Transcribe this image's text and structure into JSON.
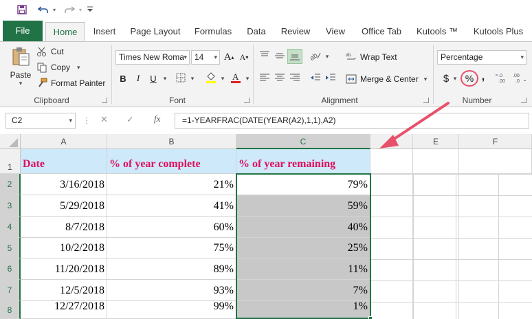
{
  "qat": {
    "save_icon": "save-icon",
    "undo_icon": "undo-icon",
    "redo_icon": "redo-icon",
    "customize_icon": "customize-qat-icon"
  },
  "tabs": [
    {
      "label": "File"
    },
    {
      "label": "Home"
    },
    {
      "label": "Insert"
    },
    {
      "label": "Page Layout"
    },
    {
      "label": "Formulas"
    },
    {
      "label": "Data"
    },
    {
      "label": "Review"
    },
    {
      "label": "View"
    },
    {
      "label": "Office Tab"
    },
    {
      "label": "Kutools ™"
    },
    {
      "label": "Kutools Plus"
    }
  ],
  "clipboard": {
    "paste": "Paste",
    "cut": "Cut",
    "copy": "Copy",
    "format_painter": "Format Painter",
    "label": "Clipboard"
  },
  "font": {
    "name": "Times New Roma",
    "size": "14",
    "bold": "B",
    "italic": "I",
    "underline": "U",
    "label": "Font",
    "grow": "A",
    "shrink": "A"
  },
  "alignment": {
    "wrap_text": "Wrap Text",
    "merge_center": "Merge & Center",
    "label": "Alignment"
  },
  "number": {
    "format": "Percentage",
    "currency": "$",
    "percent": "%",
    "comma": ",",
    "inc_decimal": "←.0 .00",
    "dec_decimal": ".00 →.0",
    "label": "Number"
  },
  "formula_bar": {
    "name_box": "C2",
    "fx": "fx",
    "formula": "=1-YEARFRAC(DATE(YEAR(A2),1,1),A2)"
  },
  "columns": [
    "A",
    "B",
    "C",
    "E",
    "F"
  ],
  "row_numbers": [
    "1",
    "2",
    "3",
    "4",
    "5",
    "6",
    "7",
    "8"
  ],
  "headers": {
    "a": "Date",
    "b": "% of year complete",
    "c": "% of year remaining"
  },
  "rows": [
    {
      "date": "3/16/2018",
      "complete": "21%",
      "remaining": "79%"
    },
    {
      "date": "5/29/2018",
      "complete": "41%",
      "remaining": "59%"
    },
    {
      "date": "8/7/2018",
      "complete": "60%",
      "remaining": "40%"
    },
    {
      "date": "10/2/2018",
      "complete": "75%",
      "remaining": "25%"
    },
    {
      "date": "11/20/2018",
      "complete": "89%",
      "remaining": "11%"
    },
    {
      "date": "12/5/2018",
      "complete": "93%",
      "remaining": "7%"
    },
    {
      "date": "12/27/2018",
      "complete": "99%",
      "remaining": "1%"
    }
  ],
  "colors": {
    "accent": "#217346",
    "header_fill": "#cde9fa",
    "header_text": "#e0105e",
    "selection_fill": "#c8c8c8",
    "annotation": "#e8506a"
  }
}
